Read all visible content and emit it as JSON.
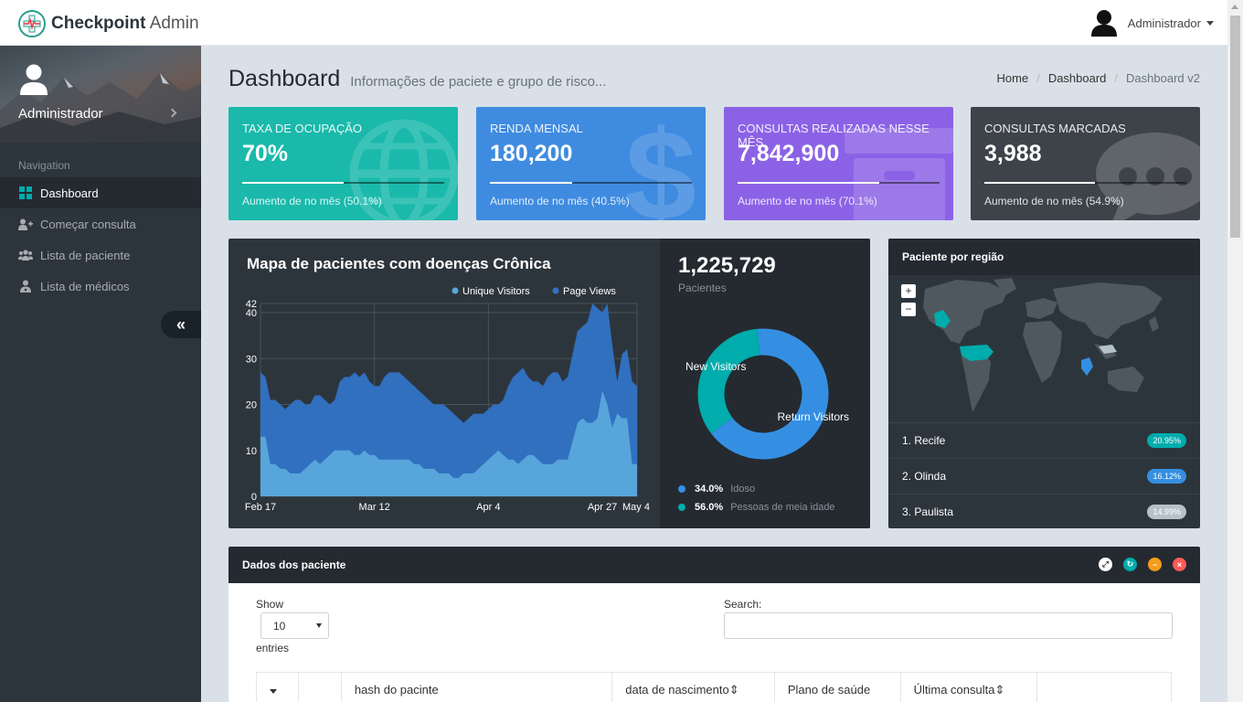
{
  "header": {
    "brand_bold": "Checkpoint",
    "brand_light": "Admin",
    "user_name": "Administrador"
  },
  "sidebar": {
    "profile_name": "Administrador",
    "nav_header": "Navigation",
    "items": [
      {
        "label": "Dashboard",
        "icon": "dashboard-grid-icon",
        "active": true
      },
      {
        "label": "Começar consulta",
        "icon": "user-plus-icon"
      },
      {
        "label": "Lista de paciente",
        "icon": "users-icon"
      },
      {
        "label": "Lista de médicos",
        "icon": "doctor-icon"
      }
    ],
    "minify_icon": "double-chevron-left-icon"
  },
  "page": {
    "title": "Dashboard",
    "subtitle": "Informações de paciete e grupo de risco...",
    "breadcrumb": [
      "Home",
      "Dashboard",
      "Dashboard v2"
    ]
  },
  "widgets": [
    {
      "label": "TAXA DE OCUPAÇÃO",
      "value": "70%",
      "progress": 0.501,
      "desc": "Aumento de no mês (50.1%)",
      "color": "#1ab9ab",
      "icon": "globe-icon"
    },
    {
      "label": "RENDA MENSAL",
      "value": "180,200",
      "progress": 0.405,
      "desc": "Aumento de no mês (40.5%)",
      "color": "#3f8be0",
      "icon": "dollar-icon"
    },
    {
      "label": "CONSULTAS REALIZADAS NESSE MÊS",
      "value": "7,842,900",
      "progress": 0.701,
      "desc": "Aumento de no mês (70.1%)",
      "color": "#8b62e6",
      "icon": "archive-icon"
    },
    {
      "label": "CONSULTAS MARCADAS",
      "value": "3,988",
      "progress": 0.549,
      "desc": "Aumento de no mês (54.9%)",
      "color": "#3d4349",
      "icon": "comments-icon"
    }
  ],
  "chart_panel": {
    "title": "Mapa de pacientes com doenças Crônica",
    "total": "1,225,729",
    "total_label": "Pacientes",
    "legend": [
      {
        "pct": "34.0%",
        "label": "Idoso",
        "color": "#348fe2"
      },
      {
        "pct": "56.0%",
        "label": "Pessoas de meia idade",
        "color": "#00acac"
      }
    ]
  },
  "chart_data": [
    {
      "type": "area",
      "ylim": [
        0,
        42
      ],
      "y_ticks": [
        0,
        10,
        20,
        30,
        40,
        42
      ],
      "x_tick_labels": [
        "Feb 17",
        "Mar 12",
        "Apr 4",
        "Apr 27",
        "May 4"
      ],
      "x_tick_index": [
        0,
        23,
        46,
        69,
        76
      ],
      "series": [
        {
          "name": "Page Views",
          "color": "#3273c6",
          "values": [
            27,
            26,
            21,
            21,
            20,
            19,
            20,
            21,
            21,
            20,
            20,
            22,
            22,
            21,
            20,
            21,
            25,
            26,
            26,
            27,
            26,
            27,
            25,
            24,
            24,
            26,
            27,
            27,
            27,
            26,
            25,
            24,
            23,
            22,
            21,
            20,
            20,
            20,
            19,
            18,
            17,
            16,
            17,
            18,
            18,
            18,
            19,
            20,
            20,
            21,
            24,
            26,
            27,
            28,
            26,
            25,
            25,
            24,
            26,
            27,
            27,
            25,
            26,
            31,
            36,
            37,
            38,
            42,
            41,
            40,
            42,
            33,
            25,
            31,
            32,
            25,
            24
          ]
        },
        {
          "name": "Unique Visitors",
          "color": "#5aa8dc",
          "values": [
            13,
            13,
            7,
            7,
            6,
            6,
            5,
            5,
            5,
            6,
            7,
            8,
            7,
            8,
            9,
            10,
            10,
            10,
            10,
            9,
            9,
            10,
            9,
            9,
            8,
            8,
            8,
            8,
            8,
            8,
            8,
            7,
            7,
            6,
            6,
            6,
            5,
            5,
            5,
            4,
            4,
            5,
            5,
            5,
            6,
            7,
            8,
            9,
            10,
            9,
            8,
            8,
            7,
            8,
            9,
            9,
            8,
            7,
            7,
            7,
            8,
            8,
            8,
            12,
            16,
            17,
            16,
            16,
            17,
            23,
            20,
            15,
            18,
            17,
            17,
            7,
            7
          ]
        }
      ]
    },
    {
      "type": "pie",
      "categories": [
        "New Visitors",
        "Return Visitors"
      ],
      "values": [
        34,
        66
      ],
      "colors": [
        "#00acac",
        "#348fe2"
      ]
    }
  ],
  "region_panel": {
    "title": "Paciente por região",
    "zoom_in": "+",
    "zoom_out": "−",
    "rows": [
      {
        "label": "1. Recife",
        "badge": "20.95%",
        "color": "#00acac"
      },
      {
        "label": "2. Olinda",
        "badge": "16.12%",
        "color": "#348fe2"
      },
      {
        "label": "3. Paulista",
        "badge": "14.99%",
        "color": "#b6c2c9"
      }
    ]
  },
  "table_panel": {
    "title": "Dados dos paciente",
    "show_label": "Show",
    "page_size": "10",
    "entries_label": "entries",
    "search_label": "Search:",
    "search_value": "",
    "columns": [
      "",
      "",
      "hash do pacinte",
      "data de nascimento",
      "Plano de saúde",
      "Última consulta",
      ""
    ],
    "column_sortable": [
      false,
      false,
      false,
      true,
      false,
      true,
      false
    ],
    "tool_colors": [
      "#ffffff",
      "#00acac",
      "#f59c1a",
      "#ff5b57"
    ]
  }
}
